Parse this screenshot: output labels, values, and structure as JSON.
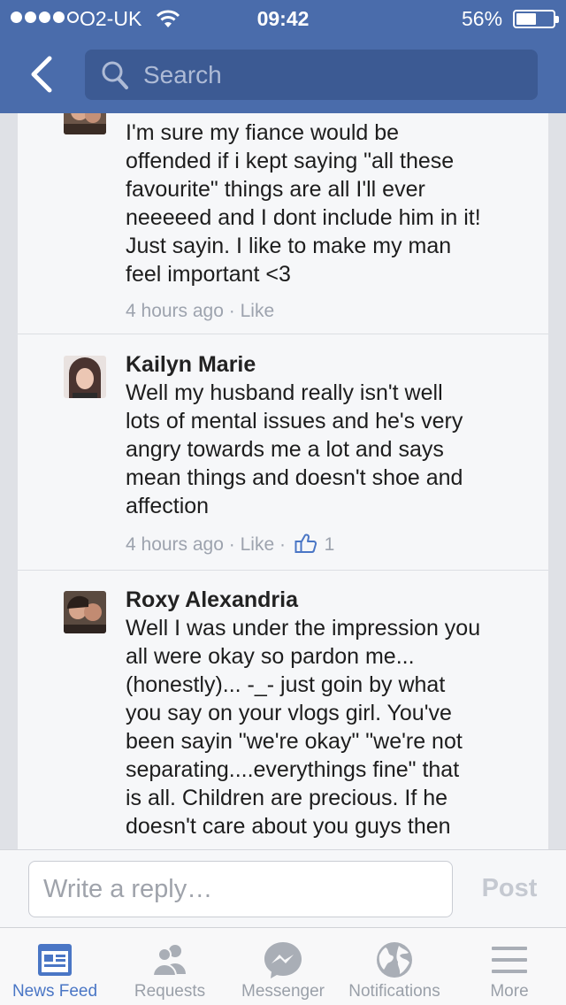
{
  "status_bar": {
    "carrier": "O2-UK",
    "time": "09:42",
    "battery_percent": "56%",
    "battery_level": 0.56,
    "signal_bars_filled": 4,
    "signal_bars_total": 5
  },
  "nav": {
    "back_icon": "chevron-left-icon",
    "search_placeholder": "Search"
  },
  "comments": [
    {
      "name": "",
      "body": "I'm sure my fiance would be\noffended if i kept saying \"all these\nfavourite\" things are all I'll ever\nneeeeed and I dont include him in it!\nJust sayin. I like to make my man\nfeel important <3",
      "time": "4 hours ago",
      "like_label": "Like",
      "like_count": ""
    },
    {
      "name": "Kailyn Marie",
      "body": "Well my husband really isn't well\nlots of mental issues and he's very\nangry towards me a lot and says\nmean things and doesn't shoe and\naffection",
      "time": "4 hours ago",
      "like_label": "Like",
      "like_count": "1"
    },
    {
      "name": "Roxy Alexandria",
      "body": "Well I was under the impression you\nall were okay so pardon me...\n(honestly)... -_-  just goin by what\nyou say on your vlogs girl. You've\nbeen sayin \"we're okay\" \"we're not\nseparating....everythings fine\" that\nis all. Children are precious. If he\ndoesn't care about you guys then",
      "time": "",
      "like_label": "",
      "like_count": ""
    }
  ],
  "meta_separator": "·",
  "reply": {
    "placeholder": "Write a reply…",
    "post_label": "Post"
  },
  "tabs": [
    {
      "label": "News Feed",
      "icon": "news-feed-icon",
      "active": true
    },
    {
      "label": "Requests",
      "icon": "friend-requests-icon",
      "active": false
    },
    {
      "label": "Messenger",
      "icon": "messenger-icon",
      "active": false
    },
    {
      "label": "Notifications",
      "icon": "globe-icon",
      "active": false
    },
    {
      "label": "More",
      "icon": "menu-icon",
      "active": false
    }
  ],
  "colors": {
    "header": "#4a6cab",
    "active_tab": "#4a76c5",
    "inactive_tab": "#9aa0a9"
  }
}
